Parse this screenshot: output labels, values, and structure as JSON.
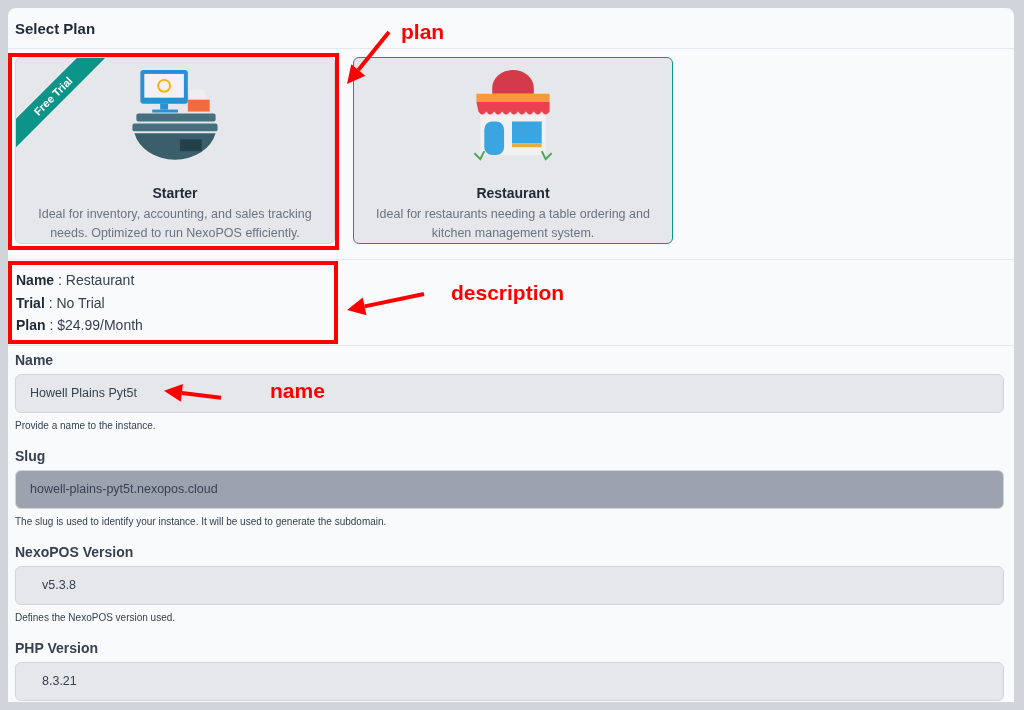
{
  "section_title": "Select Plan",
  "plans": [
    {
      "name": "Starter",
      "description": "Ideal for inventory, accounting, and sales tracking needs. Optimized to run NexoPOS efficiently.",
      "badge": "Free Trial",
      "kind": "pos",
      "selected": false,
      "highlighted": true
    },
    {
      "name": "Restaurant",
      "description": "Ideal for restaurants needing a table ordering and kitchen management system.",
      "kind": "restaurant",
      "selected": true,
      "highlighted": false
    }
  ],
  "summary": {
    "highlighted": true,
    "lines": [
      {
        "label": "Name",
        "value": ": Restaurant"
      },
      {
        "label": "Trial",
        "value": ": No Trial"
      },
      {
        "label": "Plan",
        "value": ": $24.99/Month"
      }
    ]
  },
  "fields": [
    {
      "label": "Name",
      "value": "Howell Plains Pyt5t",
      "hint": "Provide a name to the instance.",
      "disabled": false,
      "indent": false
    },
    {
      "label": "Slug",
      "value": "howell-plains-pyt5t.nexopos.cloud",
      "hint": "The slug is used to identify your instance. It will be used to generate the subdomain.",
      "disabled": true,
      "indent": false
    },
    {
      "label": "NexoPOS Version",
      "value": "v5.3.8",
      "hint": "Defines the NexoPOS version used.",
      "disabled": false,
      "indent": true
    },
    {
      "label": "PHP Version",
      "value": "8.3.21",
      "disabled": false,
      "indent": true
    }
  ],
  "annotations": [
    {
      "label": "plan"
    },
    {
      "label": "description"
    },
    {
      "label": "name"
    }
  ]
}
